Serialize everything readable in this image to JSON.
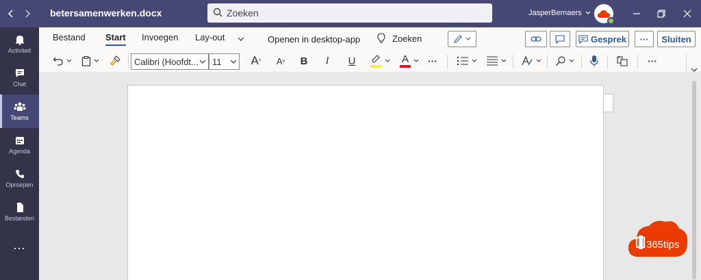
{
  "window": {
    "document_title": "betersamenwerken.docx",
    "search_placeholder": "Zoeken",
    "user_name": "JasperBernaers"
  },
  "rail": {
    "items": [
      {
        "label": "Activiteit",
        "icon": "bell-icon"
      },
      {
        "label": "Chat",
        "icon": "chat-icon"
      },
      {
        "label": "Teams",
        "icon": "teams-icon"
      },
      {
        "label": "Agenda",
        "icon": "calendar-icon"
      },
      {
        "label": "Oproepen",
        "icon": "phone-icon"
      },
      {
        "label": "Bestanden",
        "icon": "file-icon"
      }
    ],
    "more": "..."
  },
  "ribbon": {
    "tabs": [
      {
        "label": "Bestand"
      },
      {
        "label": "Start"
      },
      {
        "label": "Invoegen"
      },
      {
        "label": "Lay-out"
      }
    ],
    "open_desktop": "Openen in desktop-app",
    "search_label": "Zoeken",
    "font_name": "Calibri (Hoofdt...",
    "font_size": "11",
    "bold": "B",
    "italic": "I",
    "underline": "U",
    "font_color_letter": "A",
    "grow_font": "A",
    "shrink_font": "A",
    "more": "···"
  },
  "actions": {
    "conversation": "Gesprek",
    "close": "Sluiten",
    "more": "···"
  },
  "logo": {
    "text": "365tips"
  },
  "colors": {
    "titlebar": "#464775",
    "rail": "#33344a",
    "accent": "#2b579a",
    "highlight": "#ffeb3b",
    "font_color": "#e81123",
    "logo": "#eb3c00"
  }
}
